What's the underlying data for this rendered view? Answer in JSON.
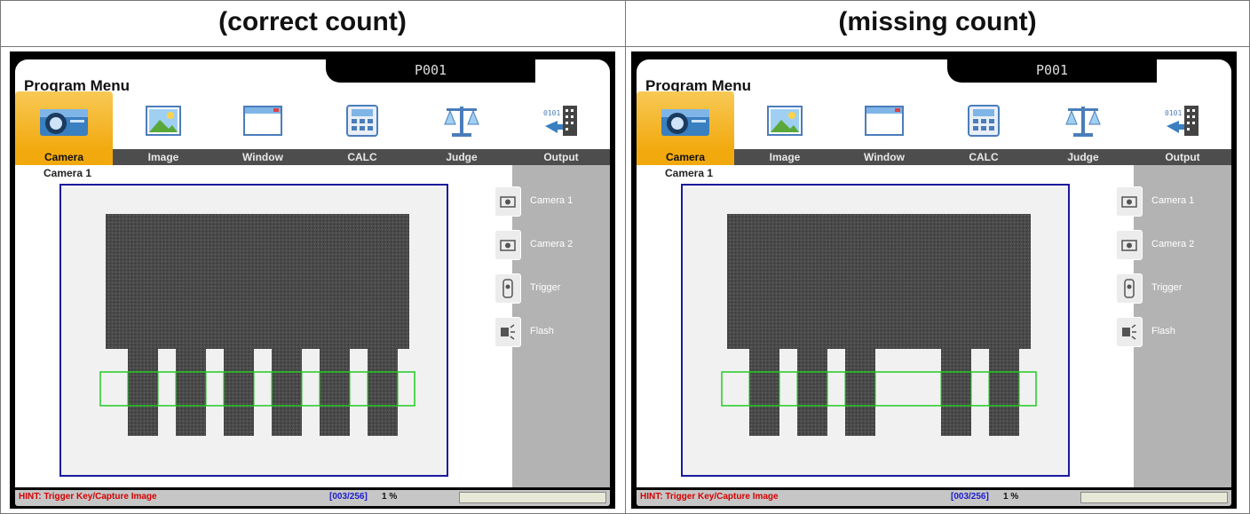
{
  "captions": {
    "left": "(correct count)",
    "right": "(missing count)"
  },
  "screen": {
    "title": "Program Menu",
    "program_id": "P001",
    "menu_icons": [
      "camera-icon",
      "image-icon",
      "window-icon",
      "calculator-icon",
      "scale-icon",
      "output-icon"
    ],
    "tabs": [
      "Camera",
      "Image",
      "Window",
      "CALC",
      "Judge",
      "Output"
    ],
    "active_tab": "Camera",
    "camera_label": "Camera 1",
    "side_items": [
      {
        "label": "Camera 1",
        "icon": "camera-icon"
      },
      {
        "label": "Camera 2",
        "icon": "camera-icon"
      },
      {
        "label": "Trigger",
        "icon": "trigger-icon"
      },
      {
        "label": "Flash",
        "icon": "flash-icon"
      }
    ],
    "hint": "HINT: Trigger Key/Capture Image",
    "count": "[003/256]",
    "percent": "1 %"
  },
  "inspection": {
    "left": {
      "pins_present": [
        true,
        true,
        true,
        true,
        true,
        true
      ]
    },
    "right": {
      "pins_present": [
        true,
        true,
        true,
        false,
        true,
        true
      ]
    }
  },
  "colors": {
    "accent": "#f2a90e",
    "tabbar": "#4d4d4d",
    "viewport_border": "#1a1aa0",
    "roi": "#22cc22",
    "hint_text": "#d40000",
    "count_text": "#1b1bd0",
    "sidebar": "#b3b3b3"
  }
}
